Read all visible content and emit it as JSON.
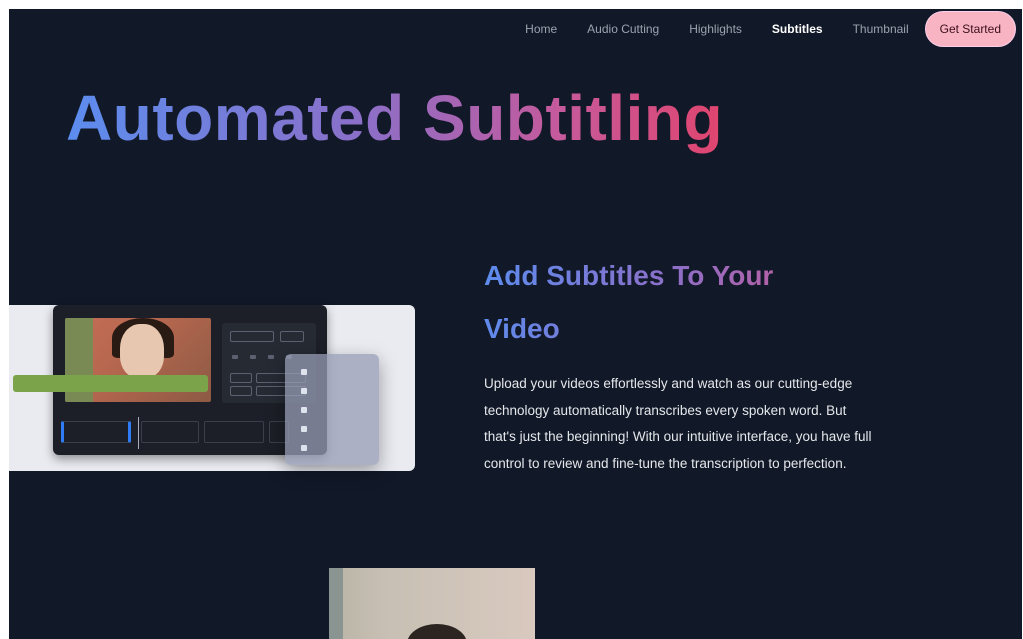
{
  "nav": {
    "items": [
      {
        "label": "Home",
        "active": false
      },
      {
        "label": "Audio Cutting",
        "active": false
      },
      {
        "label": "Highlights",
        "active": false
      },
      {
        "label": "Subtitles",
        "active": true
      },
      {
        "label": "Thumbnail",
        "active": false
      }
    ],
    "cta_label": "Get Started"
  },
  "hero": {
    "title": "Automated Subtitling"
  },
  "section": {
    "title": "Add Subtitles To Your Video",
    "description": "Upload your videos effortlessly and watch as our cutting-edge technology automatically transcribes every spoken word. But that's just the beginning! With our intuitive interface, you have full control to review and fine-tune the transcription to perfection."
  },
  "colors": {
    "background": "#111827",
    "cta_bg": "#f9b4c4",
    "gradient_start": "#5b8def",
    "gradient_end": "#e0456f"
  }
}
